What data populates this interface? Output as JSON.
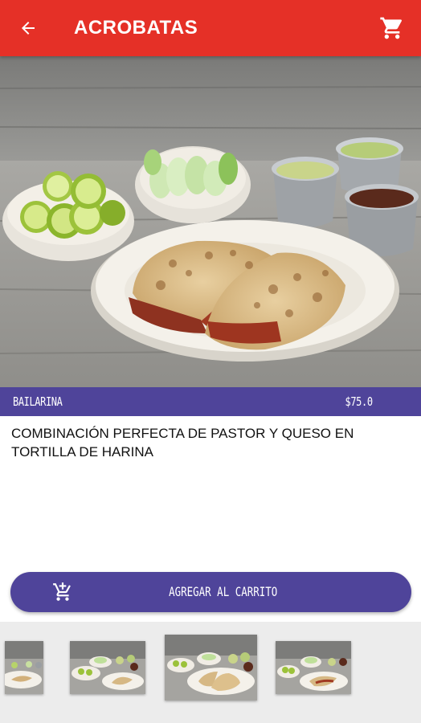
{
  "appbar": {
    "title": "ACROBATAS",
    "back_icon": "arrow-left-icon",
    "cart_icon": "shopping-cart-icon",
    "color": "#e53027"
  },
  "product": {
    "name": "BAILARINA",
    "price": "$75.0",
    "description": "COMBINACIÓN PERFECTA DE PASTOR Y QUESO EN TORTILLA DE HARINA",
    "bar_color": "#4f449a"
  },
  "actions": {
    "add_to_cart_label": "AGREGAR AL CARRITO",
    "add_to_cart_icon": "add-shopping-cart-icon"
  },
  "gallery": {
    "thumbnail_count": 4,
    "selected_index": 2
  }
}
